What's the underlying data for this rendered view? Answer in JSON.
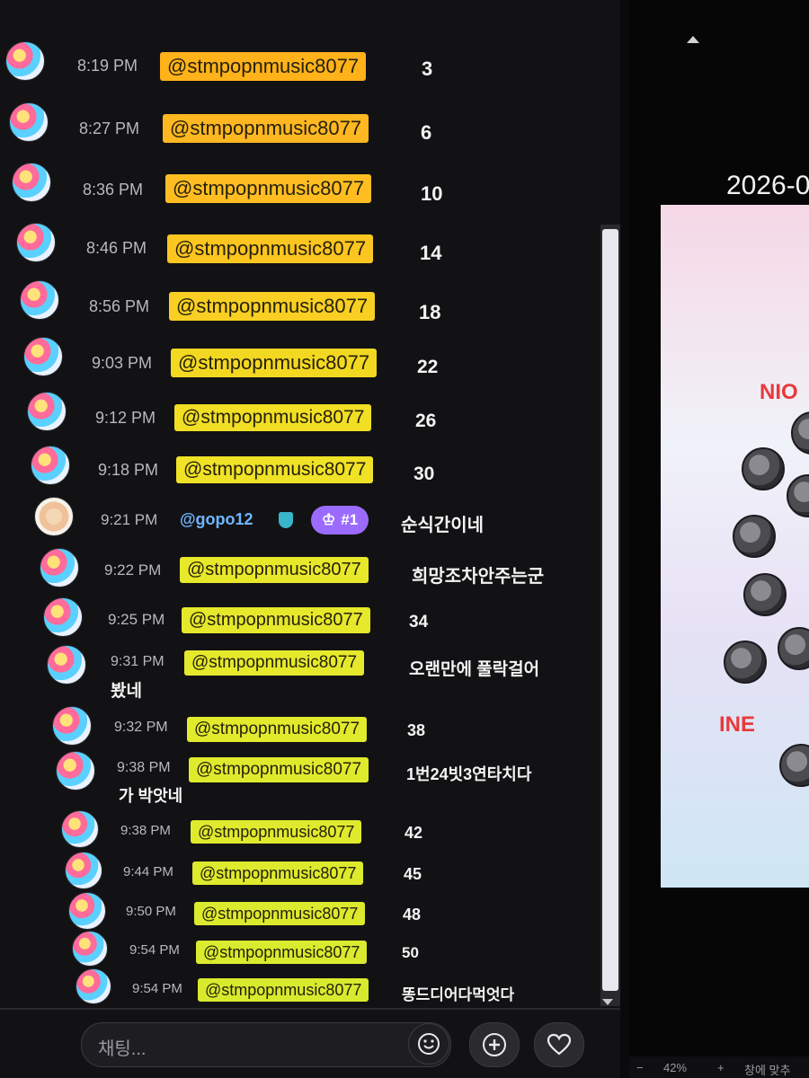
{
  "chat": {
    "messages": [
      {
        "time": "8:19 PM",
        "mention": "@stmpopnmusic8077",
        "text": "3"
      },
      {
        "time": "8:27 PM",
        "mention": "@stmpopnmusic8077",
        "text": "6"
      },
      {
        "time": "8:36 PM",
        "mention": "@stmpopnmusic8077",
        "text": "10"
      },
      {
        "time": "8:46 PM",
        "mention": "@stmpopnmusic8077",
        "text": "14"
      },
      {
        "time": "8:56 PM",
        "mention": "@stmpopnmusic8077",
        "text": "18"
      },
      {
        "time": "9:03 PM",
        "mention": "@stmpopnmusic8077",
        "text": "22"
      },
      {
        "time": "9:12 PM",
        "mention": "@stmpopnmusic8077",
        "text": "26"
      },
      {
        "time": "9:18 PM",
        "mention": "@stmpopnmusic8077",
        "text": "30"
      },
      {
        "time": "9:21 PM",
        "user": "@gopo12",
        "badge": "#1",
        "text": "순식간이네"
      },
      {
        "time": "9:22 PM",
        "mention": "@stmpopnmusic8077",
        "text": "희망조차안주는군"
      },
      {
        "time": "9:25 PM",
        "mention": "@stmpopnmusic8077",
        "text": "34"
      },
      {
        "time": "9:31 PM",
        "mention": "@stmpopnmusic8077",
        "text": "오랜만에 풀락걸어",
        "text_cont": "봤네"
      },
      {
        "time": "9:32 PM",
        "mention": "@stmpopnmusic8077",
        "text": "38"
      },
      {
        "time": "9:38 PM",
        "mention": "@stmpopnmusic8077",
        "text": "1번24빗3연타치다",
        "text_cont": "가 박앗네"
      },
      {
        "time": "9:38 PM",
        "mention": "@stmpopnmusic8077",
        "text": "42"
      },
      {
        "time": "9:44 PM",
        "mention": "@stmpopnmusic8077",
        "text": "45"
      },
      {
        "time": "9:50 PM",
        "mention": "@stmpopnmusic8077",
        "text": "48"
      },
      {
        "time": "9:54 PM",
        "mention": "@stmpopnmusic8077",
        "text": "50"
      },
      {
        "time": "9:54 PM",
        "mention": "@stmpopnmusic8077",
        "text": "똥드디어다먹엇다"
      }
    ],
    "input_placeholder": "채팅...",
    "buttons": {
      "emoji": "emoji-icon",
      "add": "plus-icon",
      "like": "heart-icon"
    }
  },
  "stream": {
    "date_text": "2026-0",
    "overlay_texts": [
      "NIO",
      "INE"
    ]
  },
  "status_bar": {
    "minus": "−",
    "zoom": "42%",
    "plus": "+",
    "fit_label": "창에 맞추"
  },
  "colors": {
    "mention_orange": "#ffb21a",
    "mention_yellow": "#f3e32a",
    "mention_lime": "#e2ea2c",
    "username_blue": "#6fb6ff",
    "badge_purple": "#9b6bff"
  }
}
